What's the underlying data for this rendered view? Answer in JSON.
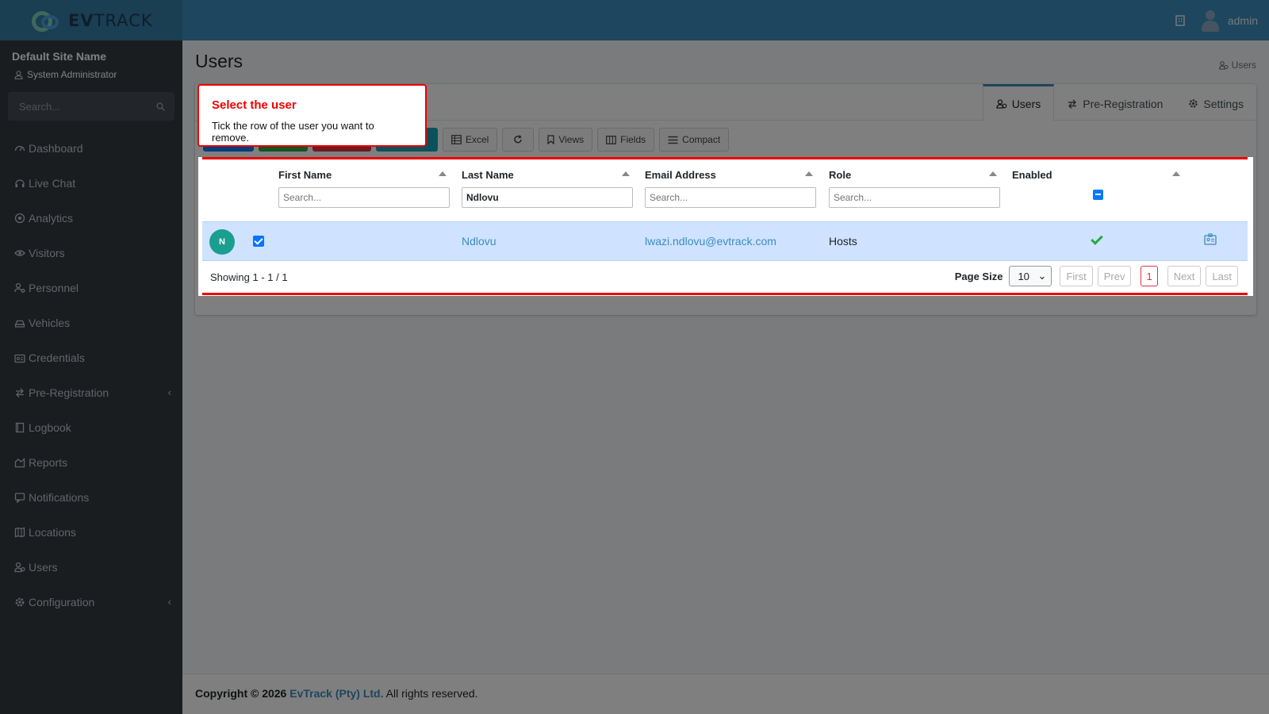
{
  "app": {
    "brand_prefix": "EV",
    "brand_suffix": "TRACK",
    "user": "admin"
  },
  "sidebar": {
    "site_name": "Default Site Name",
    "role": "System Administrator",
    "search_placeholder": "Search...",
    "items": [
      {
        "label": "Dashboard",
        "icon": "dashboard-icon"
      },
      {
        "label": "Live Chat",
        "icon": "headset-icon"
      },
      {
        "label": "Analytics",
        "icon": "target-icon"
      },
      {
        "label": "Visitors",
        "icon": "eye-icon"
      },
      {
        "label": "Personnel",
        "icon": "user-cog-icon"
      },
      {
        "label": "Vehicles",
        "icon": "car-icon"
      },
      {
        "label": "Credentials",
        "icon": "id-card-icon"
      },
      {
        "label": "Pre-Registration",
        "icon": "exchange-icon"
      },
      {
        "label": "Logbook",
        "icon": "book-icon"
      },
      {
        "label": "Reports",
        "icon": "chart-icon"
      },
      {
        "label": "Notifications",
        "icon": "message-icon"
      },
      {
        "label": "Locations",
        "icon": "map-icon"
      },
      {
        "label": "Users",
        "icon": "users-icon"
      },
      {
        "label": "Configuration",
        "icon": "gear-icon"
      }
    ]
  },
  "page": {
    "title": "Users",
    "breadcrumb": "Users"
  },
  "tabs": [
    {
      "label": "Users",
      "active": true
    },
    {
      "label": "Pre-Registration",
      "active": false
    },
    {
      "label": "Settings",
      "active": false
    }
  ],
  "toolbar": {
    "excel": "Excel",
    "views": "Views",
    "fields": "Fields",
    "compact": "Compact"
  },
  "grid": {
    "columns": [
      {
        "label": "First Name",
        "filter": "",
        "placeholder": "Search..."
      },
      {
        "label": "Last Name",
        "filter": "Ndlovu",
        "placeholder": "Search..."
      },
      {
        "label": "Email Address",
        "filter": "",
        "placeholder": "Search..."
      },
      {
        "label": "Role",
        "filter": "",
        "placeholder": "Search..."
      },
      {
        "label": "Enabled"
      }
    ],
    "rows": [
      {
        "initial": "N",
        "first_name": "",
        "last_name": "Ndlovu",
        "email": "lwazi.ndlovu@evtrack.com",
        "role": "Hosts",
        "enabled": true,
        "selected": true
      }
    ],
    "showing": "Showing 1 - 1 / 1",
    "page_size_label": "Page Size",
    "page_size": "10",
    "pager": {
      "first": "First",
      "prev": "Prev",
      "current": "1",
      "next": "Next",
      "last": "Last"
    }
  },
  "footer": {
    "copyright": "Copyright © 2026",
    "company": "EvTrack (Pty) Ltd.",
    "rights": "All rights reserved."
  },
  "tooltip": {
    "title": "Select the user",
    "body": "Tick the row of the user you want to remove."
  },
  "colors": {
    "navbar": "#3c8dbc",
    "sidebar": "#343a40",
    "highlight": "#e00000",
    "selected_row": "#cfe2ff"
  }
}
